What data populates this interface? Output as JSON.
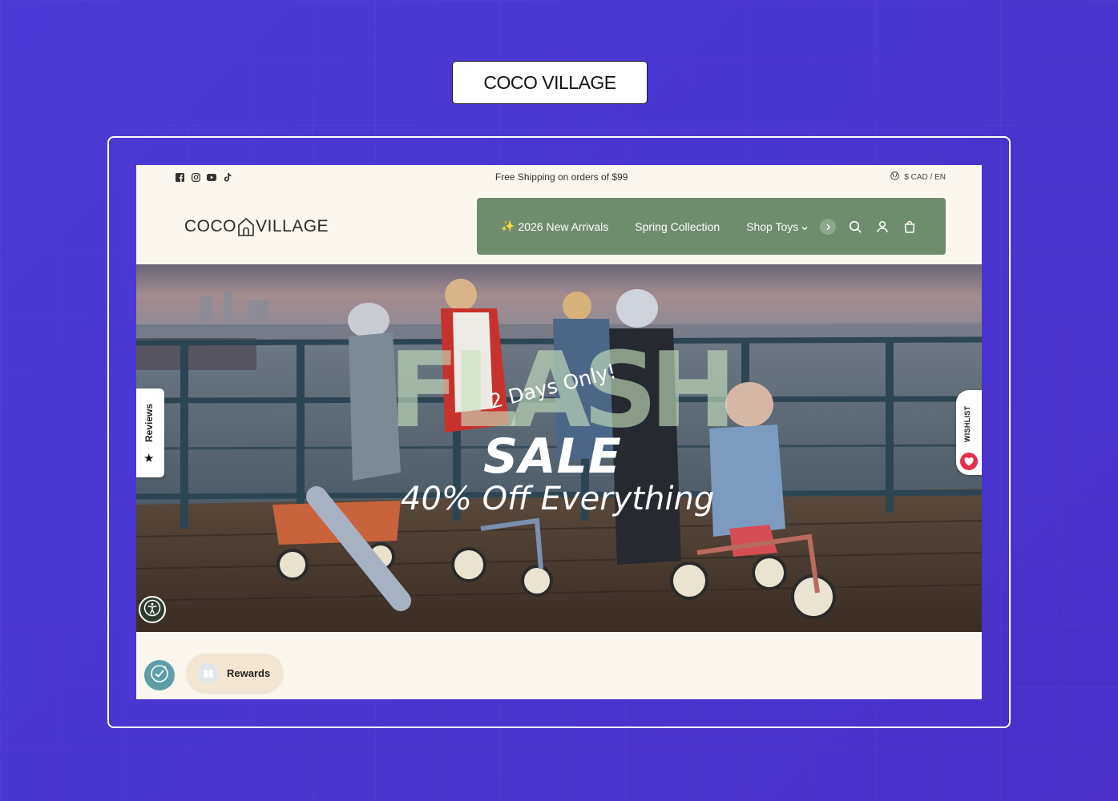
{
  "header_badge": {
    "title": "COCO VILLAGE"
  },
  "topbar": {
    "socials": [
      "facebook-icon",
      "instagram-icon",
      "youtube-icon",
      "tiktok-icon"
    ],
    "announcement": "Free Shipping on orders of $99",
    "locale": "$ CAD / EN"
  },
  "logo": {
    "left": "COCO",
    "right": "VILLAGE"
  },
  "nav": {
    "items": [
      {
        "icon": "✨",
        "label": "2026 New Arrivals"
      },
      {
        "label": "Spring Collection"
      },
      {
        "label": "Shop Toys"
      }
    ],
    "icons": [
      "search-icon",
      "account-icon",
      "cart-icon"
    ],
    "background": "#6f8c6f"
  },
  "hero": {
    "flash": "FLASH",
    "days": "2 Days Only!",
    "sale": "SALE",
    "offer": "40% Off Everything"
  },
  "widgets": {
    "reviews": "Reviews",
    "wishlist": "WISHLIST",
    "rewards": "Rewards"
  },
  "colors": {
    "page_bg": "#4c3bd6",
    "site_bg": "#fbf7ee",
    "wishlist_heart": "#e3304b",
    "rewards_bg": "#f3e6d2"
  }
}
